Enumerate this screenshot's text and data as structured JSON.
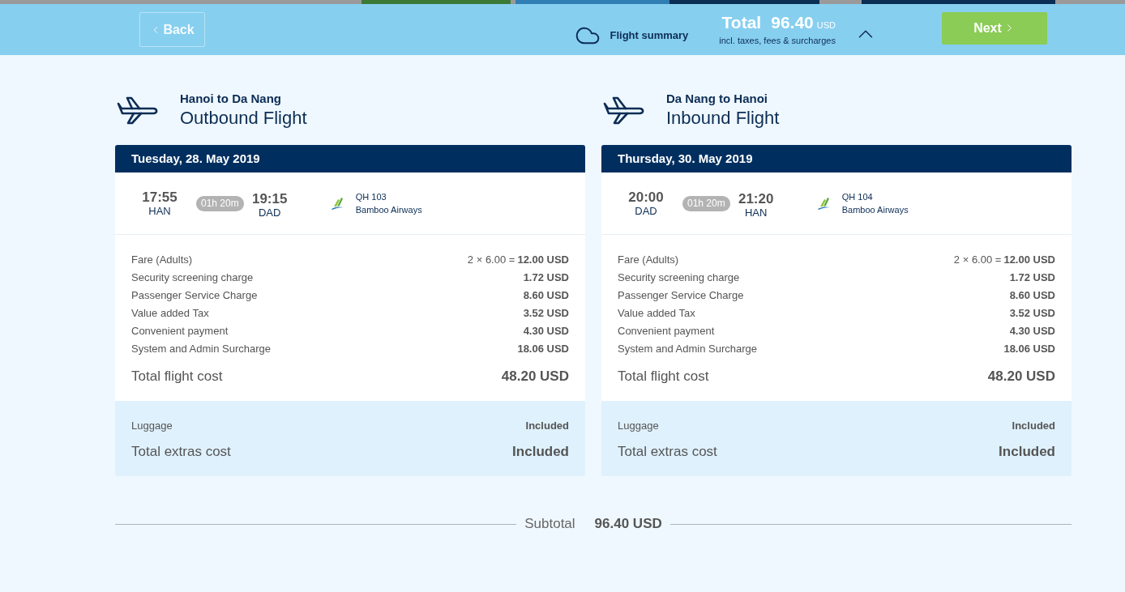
{
  "top_bar": {
    "back_button": {
      "label": "Back",
      "disabled": true
    },
    "flight_summary": "Flight summary",
    "total": {
      "label": "Total",
      "amount": "96.40",
      "currency": "USD",
      "note": "incl. taxes, fees & surcharges"
    },
    "next_button": {
      "label": "Next",
      "disabled": false
    }
  },
  "flights": [
    {
      "route": "Hanoi to Da Nang",
      "title": "Outbound Flight",
      "date": "Tuesday, 28. May 2019",
      "departure": {
        "time": "17:55",
        "airport": "HAN"
      },
      "duration": "01h 20m",
      "arrival": {
        "time": "19:15",
        "airport": "DAD"
      },
      "flight_number": "QH 103",
      "airline": "Bamboo Airways",
      "charges": [
        {
          "label": "Fare (Adults)",
          "calculation": "2 × 6.00 =",
          "amount": "12.00 USD"
        },
        {
          "label": "Security screening charge",
          "amount": "1.72 USD"
        },
        {
          "label": "Passenger Service Charge",
          "amount": "8.60 USD"
        },
        {
          "label": "Value added Tax",
          "amount": "3.52 USD"
        },
        {
          "label": "Convenient payment",
          "amount": "4.30 USD"
        },
        {
          "label": "System and Admin Surcharge",
          "amount": "18.06 USD"
        }
      ],
      "total_label": "Total flight cost",
      "total": "48.20 USD",
      "extras": [
        {
          "label": "Luggage",
          "value": "Included"
        }
      ],
      "extras_total_label": "Total extras cost",
      "extras_total": "Included"
    },
    {
      "route": "Da Nang to Hanoi",
      "title": "Inbound Flight",
      "date": "Thursday, 30. May 2019",
      "departure": {
        "time": "20:00",
        "airport": "DAD"
      },
      "duration": "01h 20m",
      "arrival": {
        "time": "21:20",
        "airport": "HAN"
      },
      "flight_number": "QH 104",
      "airline": "Bamboo Airways",
      "charges": [
        {
          "label": "Fare (Adults)",
          "calculation": "2 × 6.00 =",
          "amount": "12.00 USD"
        },
        {
          "label": "Security screening charge",
          "amount": "1.72 USD"
        },
        {
          "label": "Passenger Service Charge",
          "amount": "8.60 USD"
        },
        {
          "label": "Value added Tax",
          "amount": "3.52 USD"
        },
        {
          "label": "Convenient payment",
          "amount": "4.30 USD"
        },
        {
          "label": "System and Admin Surcharge",
          "amount": "18.06 USD"
        }
      ],
      "total_label": "Total flight cost",
      "total": "48.20 USD",
      "extras": [
        {
          "label": "Luggage",
          "value": "Included"
        }
      ],
      "extras_total_label": "Total extras cost",
      "extras_total": "Included"
    }
  ],
  "subtotal": {
    "label": "Subtotal",
    "amount": "96.40 USD"
  }
}
